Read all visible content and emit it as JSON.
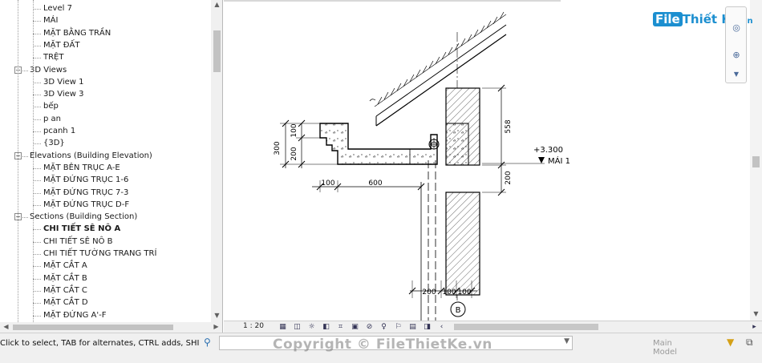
{
  "browser": {
    "items": [
      {
        "label": "Level 7",
        "indent": 2
      },
      {
        "label": "MÁI",
        "indent": 2
      },
      {
        "label": "MẶT BẰNG TRẦN",
        "indent": 2
      },
      {
        "label": "MẶT ĐẤT",
        "indent": 2
      },
      {
        "label": "TRỆT",
        "indent": 2
      },
      {
        "label": "3D Views",
        "indent": 1,
        "expander": "−"
      },
      {
        "label": "3D View 1",
        "indent": 2
      },
      {
        "label": "3D View 3",
        "indent": 2
      },
      {
        "label": "bếp",
        "indent": 2
      },
      {
        "label": "p an",
        "indent": 2
      },
      {
        "label": "pcanh 1",
        "indent": 2
      },
      {
        "label": "{3D}",
        "indent": 2
      },
      {
        "label": "Elevations (Building Elevation)",
        "indent": 1,
        "expander": "−"
      },
      {
        "label": "MẶT BÊN TRỤC A-E",
        "indent": 2
      },
      {
        "label": "MẶT ĐỨNG TRỤC 1-6",
        "indent": 2
      },
      {
        "label": "MẶT ĐỨNG TRỤC 7-3",
        "indent": 2
      },
      {
        "label": "MẶT ĐỨNG TRỤC D-F",
        "indent": 2
      },
      {
        "label": "Sections (Building Section)",
        "indent": 1,
        "expander": "−"
      },
      {
        "label": "CHI TIẾT SÊ NÔ A",
        "indent": 2,
        "selected": true
      },
      {
        "label": "CHI TIẾT SÊ NÔ B",
        "indent": 2
      },
      {
        "label": "CHI TIẾT TƯỜNG TRANG TRÍ",
        "indent": 2
      },
      {
        "label": "MẶT CẮT A",
        "indent": 2
      },
      {
        "label": "MẶT CẮT B",
        "indent": 2
      },
      {
        "label": "MẶT CẮT C",
        "indent": 2
      },
      {
        "label": "MẶT CẮT D",
        "indent": 2
      },
      {
        "label": "MẶT ĐỨNG A'-F",
        "indent": 2
      }
    ]
  },
  "viewbar": {
    "scale": "1 : 20"
  },
  "status": {
    "text": "Click to select, TAB for alternates, CTRL adds, SHIFT unse",
    "workset": "Main Model",
    "copyright": "Copyright © FileThietKe.vn"
  },
  "logo": {
    "prefix": "File",
    "name": "Thiết Kế",
    "suffix": ".vn"
  },
  "drawing": {
    "dims": {
      "d300": "300",
      "d200v": "200",
      "d100v": "100",
      "d100h": "100",
      "d600": "600",
      "d558": "558",
      "d200r": "200",
      "b200": "200",
      "b100a": "100",
      "b100b": "100"
    },
    "level": {
      "value": "+3.300",
      "name": "MÁI 1"
    },
    "grid": "B"
  },
  "colors": {
    "line": "#000000",
    "accent": "#1c8fd0"
  }
}
